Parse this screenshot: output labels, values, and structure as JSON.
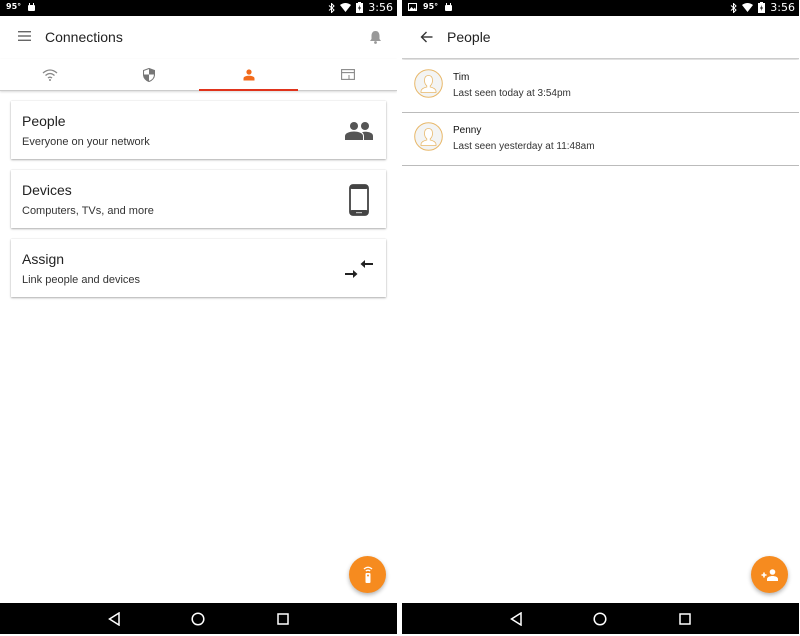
{
  "colors": {
    "accent": "#e0331b",
    "fab": "#f68b1f",
    "avatar_ring": "#e8b86a"
  },
  "left_screen": {
    "status_bar": {
      "temperature": "95°",
      "time": "3:56",
      "icons": [
        "android-icon",
        "bluetooth-icon",
        "wifi-icon",
        "battery-charging-icon"
      ]
    },
    "app_bar": {
      "title": "Connections",
      "menu_icon": "hamburger-menu-icon",
      "notification_icon": "bell-icon"
    },
    "tabs": [
      {
        "icon": "wifi-icon",
        "active": false
      },
      {
        "icon": "shield-icon",
        "active": false
      },
      {
        "icon": "person-icon",
        "active": true
      },
      {
        "icon": "browser-window-icon",
        "active": false
      }
    ],
    "cards": [
      {
        "title": "People",
        "subtitle": "Everyone on your network",
        "icon": "people-icon"
      },
      {
        "title": "Devices",
        "subtitle": "Computers, TVs, and more",
        "icon": "smartphone-icon"
      },
      {
        "title": "Assign",
        "subtitle": "Link people and devices",
        "icon": "assign-arrows-icon"
      }
    ],
    "fab": {
      "icon": "remote-control-icon"
    }
  },
  "right_screen": {
    "status_bar": {
      "temperature": "95°",
      "time": "3:56",
      "icons": [
        "image-icon",
        "android-icon",
        "bluetooth-icon",
        "wifi-icon",
        "battery-charging-icon"
      ]
    },
    "app_bar": {
      "title": "People",
      "back_icon": "back-arrow-icon"
    },
    "people": [
      {
        "name": "Tim",
        "last_seen": "Last seen today at 3:54pm"
      },
      {
        "name": "Penny",
        "last_seen": "Last seen yesterday at 11:48am"
      }
    ],
    "fab": {
      "icon": "add-person-icon"
    }
  },
  "nav_bar": {
    "buttons": [
      "back-icon",
      "home-icon",
      "recents-icon"
    ]
  }
}
